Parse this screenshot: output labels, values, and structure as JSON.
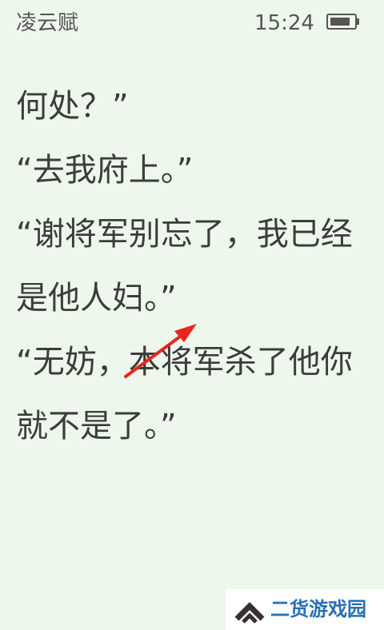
{
  "status_bar": {
    "book_title": "凌云赋",
    "time": "15:24",
    "battery_level": 0.85
  },
  "reader": {
    "lines": [
      "何处？”",
      "“去我府上。”",
      "“谢将军别忘了，我已经",
      "是他人妇。”",
      "“无妨，本将军杀了他你",
      "就不是了。”"
    ]
  },
  "annotation": {
    "arrow_color": "#e8261f"
  },
  "watermark": {
    "text": "二货游戏园",
    "text_color": "#2a6fb5",
    "logo_color": "#3a2f2f"
  }
}
